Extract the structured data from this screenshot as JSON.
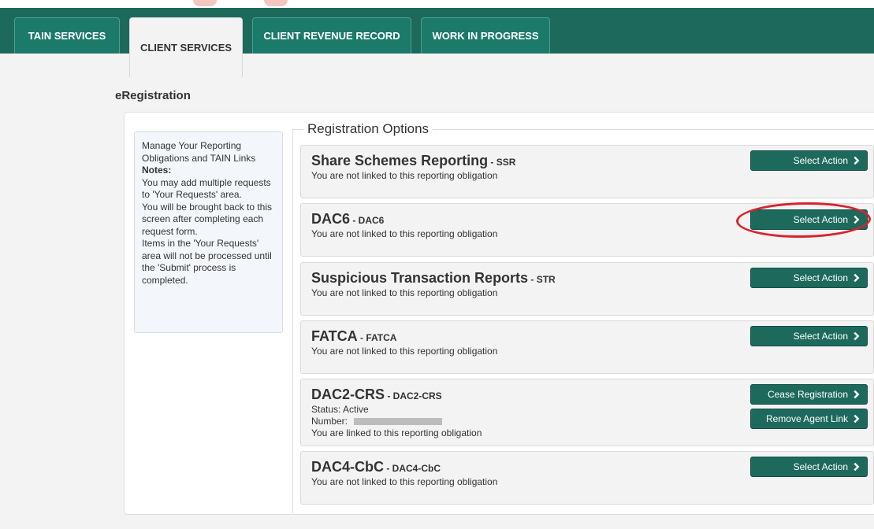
{
  "tabs": [
    {
      "label": "TAIN SERVICES"
    },
    {
      "label": "CLIENT SERVICES"
    },
    {
      "label": "CLIENT REVENUE RECORD"
    },
    {
      "label": "WORK IN PROGRESS"
    }
  ],
  "page_title": "eRegistration",
  "notes": {
    "line1": "Manage Your Reporting Obligations and TAIN Links",
    "heading": "Notes:",
    "line2": "You may add multiple requests to 'Your Requests' area.",
    "line3": "You will be brought back to this screen after completing each request form.",
    "line4": "Items in the 'Your Requests' area will not be processed until the 'Submit' process is completed."
  },
  "section_title": "Registration Options",
  "options": [
    {
      "name": "Share Schemes Reporting",
      "code": " - SSR",
      "status": "You are not linked to this reporting obligation",
      "button": "Select Action"
    },
    {
      "name": "DAC6",
      "code": " - DAC6",
      "status": "You are not linked to this reporting obligation",
      "button": "Select Action"
    },
    {
      "name": "Suspicious Transaction Reports",
      "code": " - STR",
      "status": "You are not linked to this reporting obligation",
      "button": "Select Action"
    },
    {
      "name": "FATCA",
      "code": " - FATCA",
      "status": "You are not linked to this reporting obligation",
      "button": "Select Action"
    },
    {
      "name": "DAC2-CRS",
      "code": " - DAC2-CRS",
      "status_active": "Status: Active",
      "number_label": "Number:",
      "status": "You are linked to this reporting obligation",
      "button1": "Cease Registration",
      "button2": "Remove Agent Link"
    },
    {
      "name": "DAC4-CbC",
      "code": " - DAC4-CbC",
      "status": "You are not linked to this reporting obligation",
      "button": "Select Action"
    }
  ],
  "colors": {
    "brand_green": "#1d6a5c",
    "highlight_red": "#d9232d"
  },
  "icons": {
    "chevron": "chevron-right-icon"
  }
}
